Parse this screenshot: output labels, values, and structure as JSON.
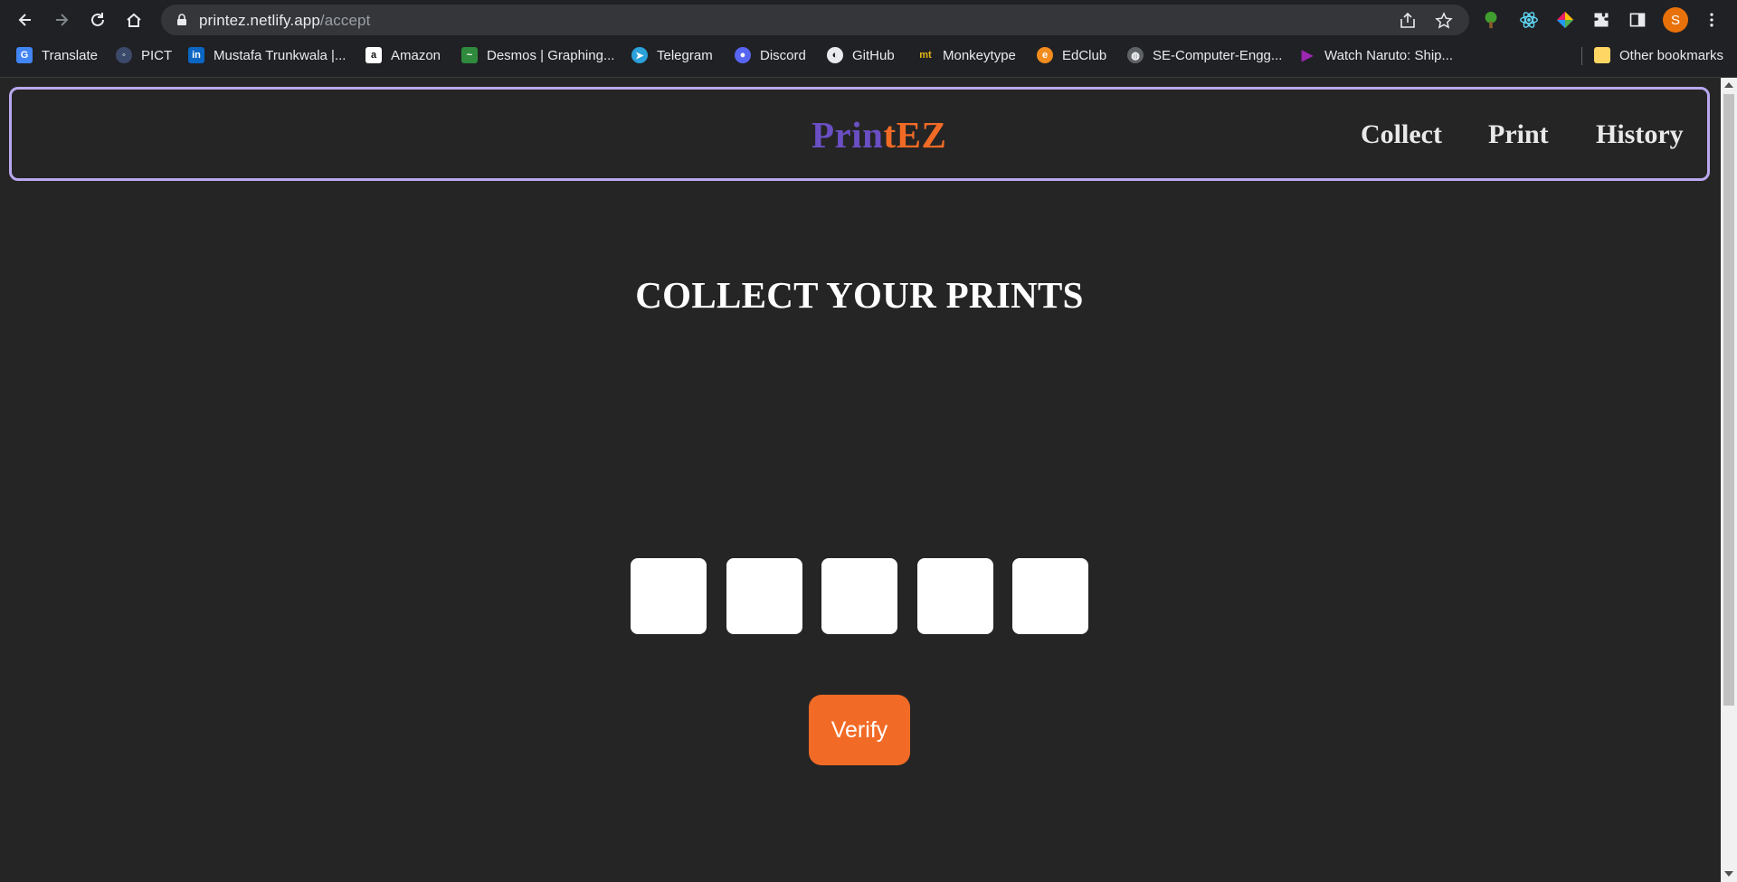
{
  "browser": {
    "url_host": "printez.netlify.app",
    "url_path": "/accept",
    "profile_initial": "S",
    "bookmarks": [
      {
        "label": "Translate",
        "icon": "google-translate-icon"
      },
      {
        "label": "PICT",
        "icon": "pict-icon"
      },
      {
        "label": "Mustafa Trunkwala |...",
        "icon": "linkedin-icon"
      },
      {
        "label": "Amazon",
        "icon": "amazon-icon"
      },
      {
        "label": "Desmos | Graphing...",
        "icon": "desmos-icon"
      },
      {
        "label": "Telegram",
        "icon": "telegram-icon"
      },
      {
        "label": "Discord",
        "icon": "discord-icon"
      },
      {
        "label": "GitHub",
        "icon": "github-icon"
      },
      {
        "label": "Monkeytype",
        "icon": "monkeytype-icon"
      },
      {
        "label": "EdClub",
        "icon": "edclub-icon"
      },
      {
        "label": "SE-Computer-Engg...",
        "icon": "globe-icon"
      },
      {
        "label": "Watch Naruto: Ship...",
        "icon": "play-icon"
      }
    ],
    "other_bookmarks": "Other bookmarks"
  },
  "navbar": {
    "brand_part1": "Prin",
    "brand_part2": "tEZ",
    "links": [
      "Collect",
      "Print",
      "History"
    ]
  },
  "main": {
    "heading": "COLLECT YOUR PRINTS",
    "otp_values": [
      "",
      "",
      "",
      "",
      ""
    ],
    "verify_label": "Verify"
  },
  "colors": {
    "accent_orange": "#f26b26",
    "accent_purple": "#6a4fc4",
    "navbar_border": "#b9a8ee",
    "background": "#252525"
  }
}
